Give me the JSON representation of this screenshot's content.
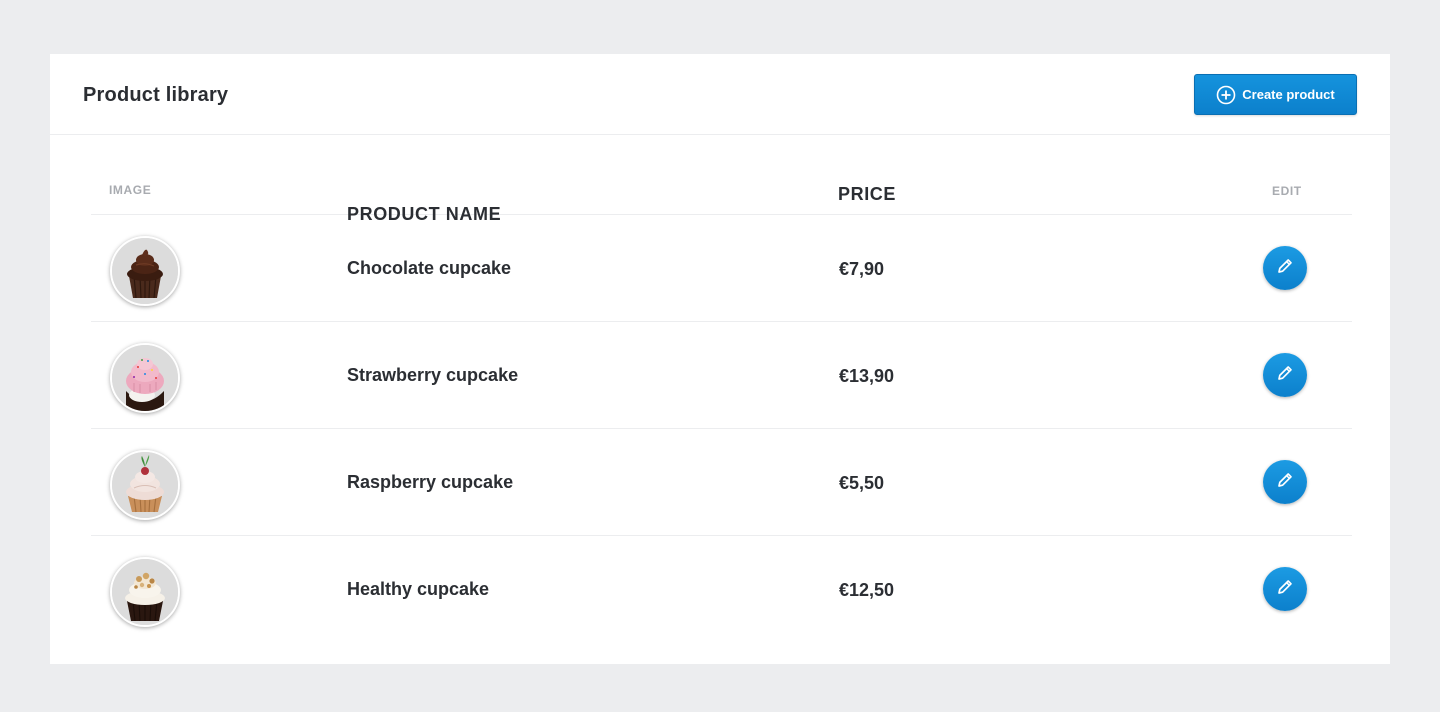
{
  "header": {
    "title": "Product library",
    "create_button": {
      "label": "Create product",
      "icon": "plus-circle-icon"
    }
  },
  "table": {
    "columns": {
      "image": "IMAGE",
      "name": "PRODUCT NAME",
      "price": "PRICE",
      "edit": "EDIT"
    },
    "rows": [
      {
        "name": "Chocolate cupcake",
        "price": "€7,90",
        "image": "chocolate-cupcake-photo",
        "edit_icon": "pencil-icon"
      },
      {
        "name": "Strawberry cupcake",
        "price": "€13,90",
        "image": "strawberry-cupcake-photo",
        "edit_icon": "pencil-icon"
      },
      {
        "name": "Raspberry cupcake",
        "price": "€5,50",
        "image": "raspberry-cupcake-photo",
        "edit_icon": "pencil-icon"
      },
      {
        "name": "Healthy cupcake",
        "price": "€12,50",
        "image": "healthy-cupcake-photo",
        "edit_icon": "pencil-icon"
      }
    ]
  },
  "colors": {
    "background": "#ECEDEF",
    "card": "#FFFFFF",
    "accent": "#1593DD",
    "text": "#2B2E33",
    "muted": "#A8ABB0"
  }
}
